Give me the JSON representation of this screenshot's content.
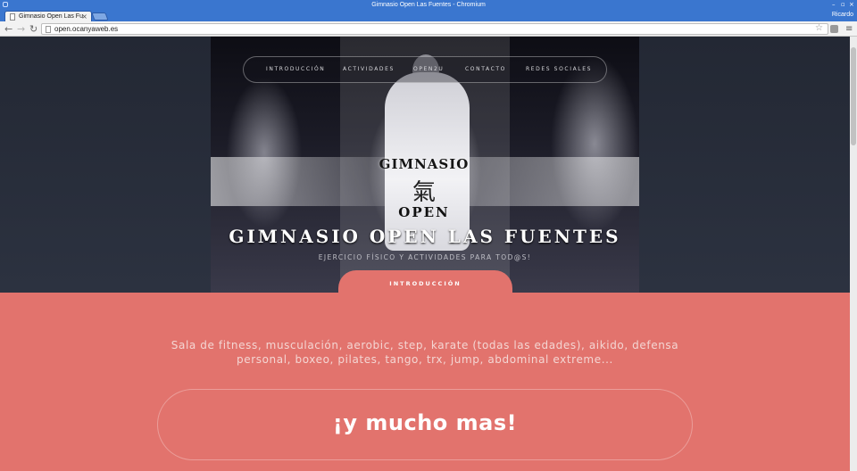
{
  "window": {
    "title": "Gimnasio Open Las Fuentes - Chromium",
    "profile": "Ricardo"
  },
  "tabs": [
    {
      "label": "Gimnasio Open Las Fu"
    }
  ],
  "toolbar": {
    "url": "open.ocanyaweb.es"
  },
  "site": {
    "nav": [
      "INTRODUCCIÓN",
      "ACTIVIDADES",
      "OPEN2U",
      "CONTACTO",
      "REDES SOCIALES"
    ],
    "logo": {
      "line1": "GIMNASIO",
      "kanji": "氣",
      "line2": "OPEN"
    },
    "title": "GIMNASIO OPEN LAS FUENTES",
    "subtitle": "EJERCICIO FÍSICO Y ACTIVIDADES PARA TOD@S!",
    "section_tab": "INTRODUCCIÓN",
    "intro_text": "Sala de fitness, musculación, aerobic, step, karate (todas las edades), aikido, defensa personal, boxeo, pilates, tango, trx, jump, abdominal extreme...",
    "highlight": "¡y mucho mas!"
  },
  "colors": {
    "accent": "#e2736d",
    "hero_bg": "#2a2f3a",
    "chrome": "#3a76cf"
  }
}
